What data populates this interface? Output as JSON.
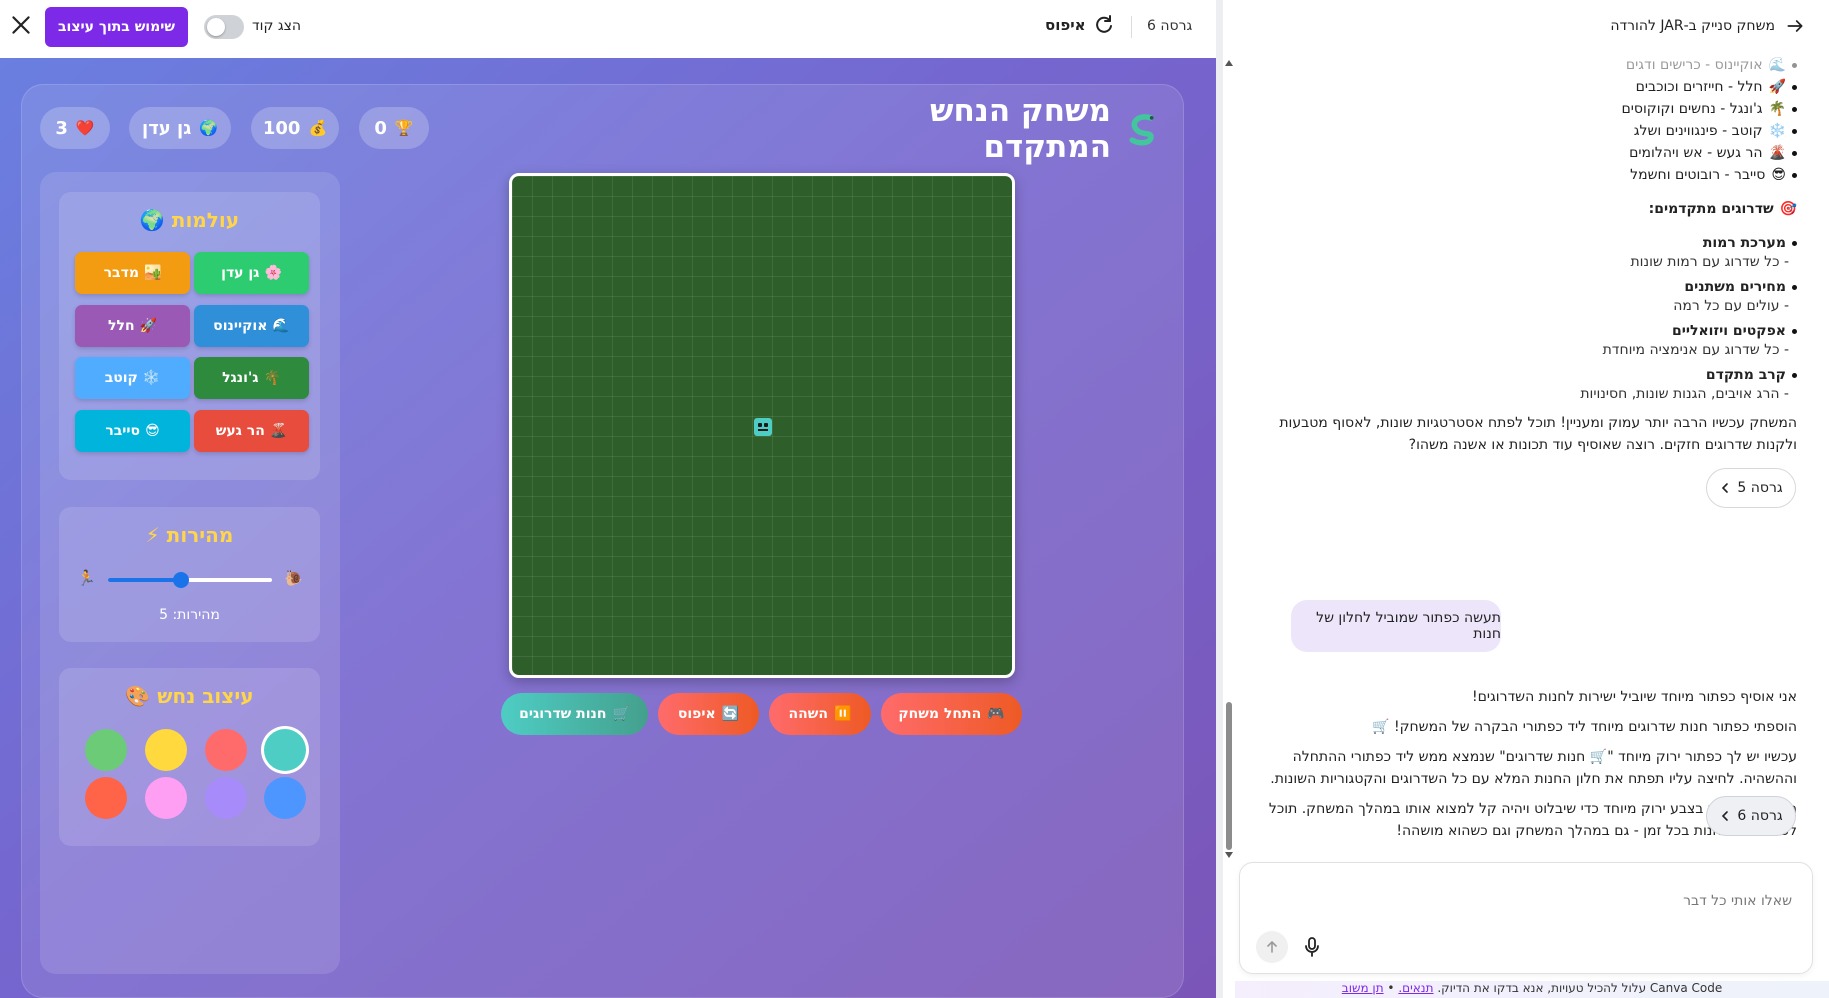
{
  "topbar": {
    "use_in_design": "שימוש בתוך עיצוב",
    "show_code": "הצג קוד",
    "reset": "איפוס",
    "version": "גרסה 6"
  },
  "game": {
    "title": "משחק הנחש המתקדם",
    "stats": {
      "score": "0",
      "coins": "100",
      "world": "גן עדן",
      "lives": "3"
    },
    "worlds_title": "עולמות",
    "worlds": [
      {
        "label": "גן עדן",
        "emoji": "🌸",
        "color": "#2ecc71"
      },
      {
        "label": "מדבר",
        "emoji": "🏜️",
        "color": "#f39c12"
      },
      {
        "label": "אוקיינוס",
        "emoji": "🌊",
        "color": "#2f8fd8"
      },
      {
        "label": "חלל",
        "emoji": "🚀",
        "color": "#9b59b6"
      },
      {
        "label": "ג'ונגל",
        "emoji": "🌴",
        "color": "#2e8b3e"
      },
      {
        "label": "קוטב",
        "emoji": "❄️",
        "color": "#4facfe"
      },
      {
        "label": "הר געש",
        "emoji": "🌋",
        "color": "#e74c3c"
      },
      {
        "label": "סייבר",
        "emoji": "😎",
        "color": "#00b4db"
      }
    ],
    "speed_title": "מהירות",
    "speed_label": "מהירות: 5",
    "speed_value": 5,
    "speed_min": 1,
    "speed_max": 10,
    "snake_title": "עיצוב נחש",
    "snake_colors": [
      "#4ecdc4",
      "#ff6b6b",
      "#ffd93d",
      "#6bcb77",
      "#4d96ff",
      "#a78bfa",
      "#ff9ff3",
      "#ff6348"
    ],
    "selected_color_index": 0,
    "controls": {
      "start": "התחל משחק",
      "pause": "השהה",
      "reset": "איפוס",
      "shop": "חנות שדרוגים"
    }
  },
  "chat": {
    "title": "משחק סנייק ב-JAR להורדה",
    "worlds_list": [
      {
        "emoji": "🌊",
        "text": "אוקיינוס - כרישים ודגים",
        "faded": true
      },
      {
        "emoji": "🚀",
        "text": "חלל - חייזרים וכוכבים"
      },
      {
        "emoji": "🌴",
        "text": "ג'ונגל - נחשים וקוקוסים"
      },
      {
        "emoji": "❄️",
        "text": "קוטב - פינגווינים ושלג"
      },
      {
        "emoji": "🌋",
        "text": "הר געש - אש ויהלומים"
      },
      {
        "emoji": "😎",
        "text": "סייבר - רובוטים וחשמל"
      }
    ],
    "upgrades_heading": "שדרוגים מתקדמים:",
    "upgrades": [
      {
        "title": "מערכת רמות",
        "desc": "- כל שדרוג עם רמות שונות"
      },
      {
        "title": "מחירים משתנים",
        "desc": "- עולים עם כל רמה"
      },
      {
        "title": "אפקטים ויזואליים",
        "desc": "- כל שדרוג עם אנימציה מיוחדת"
      },
      {
        "title": "קרב מתקדם",
        "desc": "- הרג אויבים, הגנות שונות, חסינויות"
      }
    ],
    "summary_1": "המשחק עכשיו הרבה יותר עמוק ומעניין! תוכל לפתח אסטרטגיות שונות, לאסוף מטבעות",
    "summary_2": "ולקנות שדרוגים חזקים. רוצה שאוסיף עוד תכונות או אשנה משהו?",
    "version5": "גרסה 5",
    "user_message": "תעשה כפתור שמוביל לחלון של חנות",
    "reply_1": "אני אוסיף כפתור מיוחד שיוביל ישירות לחנות השדרוגים!",
    "reply_2": "הוספתי כפתור חנות שדרוגים מיוחד ליד כפתורי הבקרה של המשחק! 🛒",
    "reply_3a": "עכשיו יש לך כפתור ירוק מיוחד \"🛒 חנות שדרוגים\" שנמצא ממש ליד כפתורי ההתחלה",
    "reply_3b": "וההשהיה. לחיצה עליו תפתח את חלון החנות המלא עם כל השדרוגים והקטגוריות השונות.",
    "reply_4a": "הכפתור מעוצב בצבע ירוק מיוחד כדי שיבלוט ויהיה קל למצוא אותו במהלך המשחק. תוכל",
    "reply_4b": "לפתוח את החנות בכל זמן - גם במהלך המשחק וגם כשהוא מושהה!",
    "version6": "גרסה 6",
    "input_placeholder": "שאלו אותי כל דבר",
    "footer_text": "Canva Code עלול להכיל טעויות, אנא בדקו את הדיוק.",
    "footer_terms": "תנאים.",
    "footer_feedback": "תן משוב"
  }
}
